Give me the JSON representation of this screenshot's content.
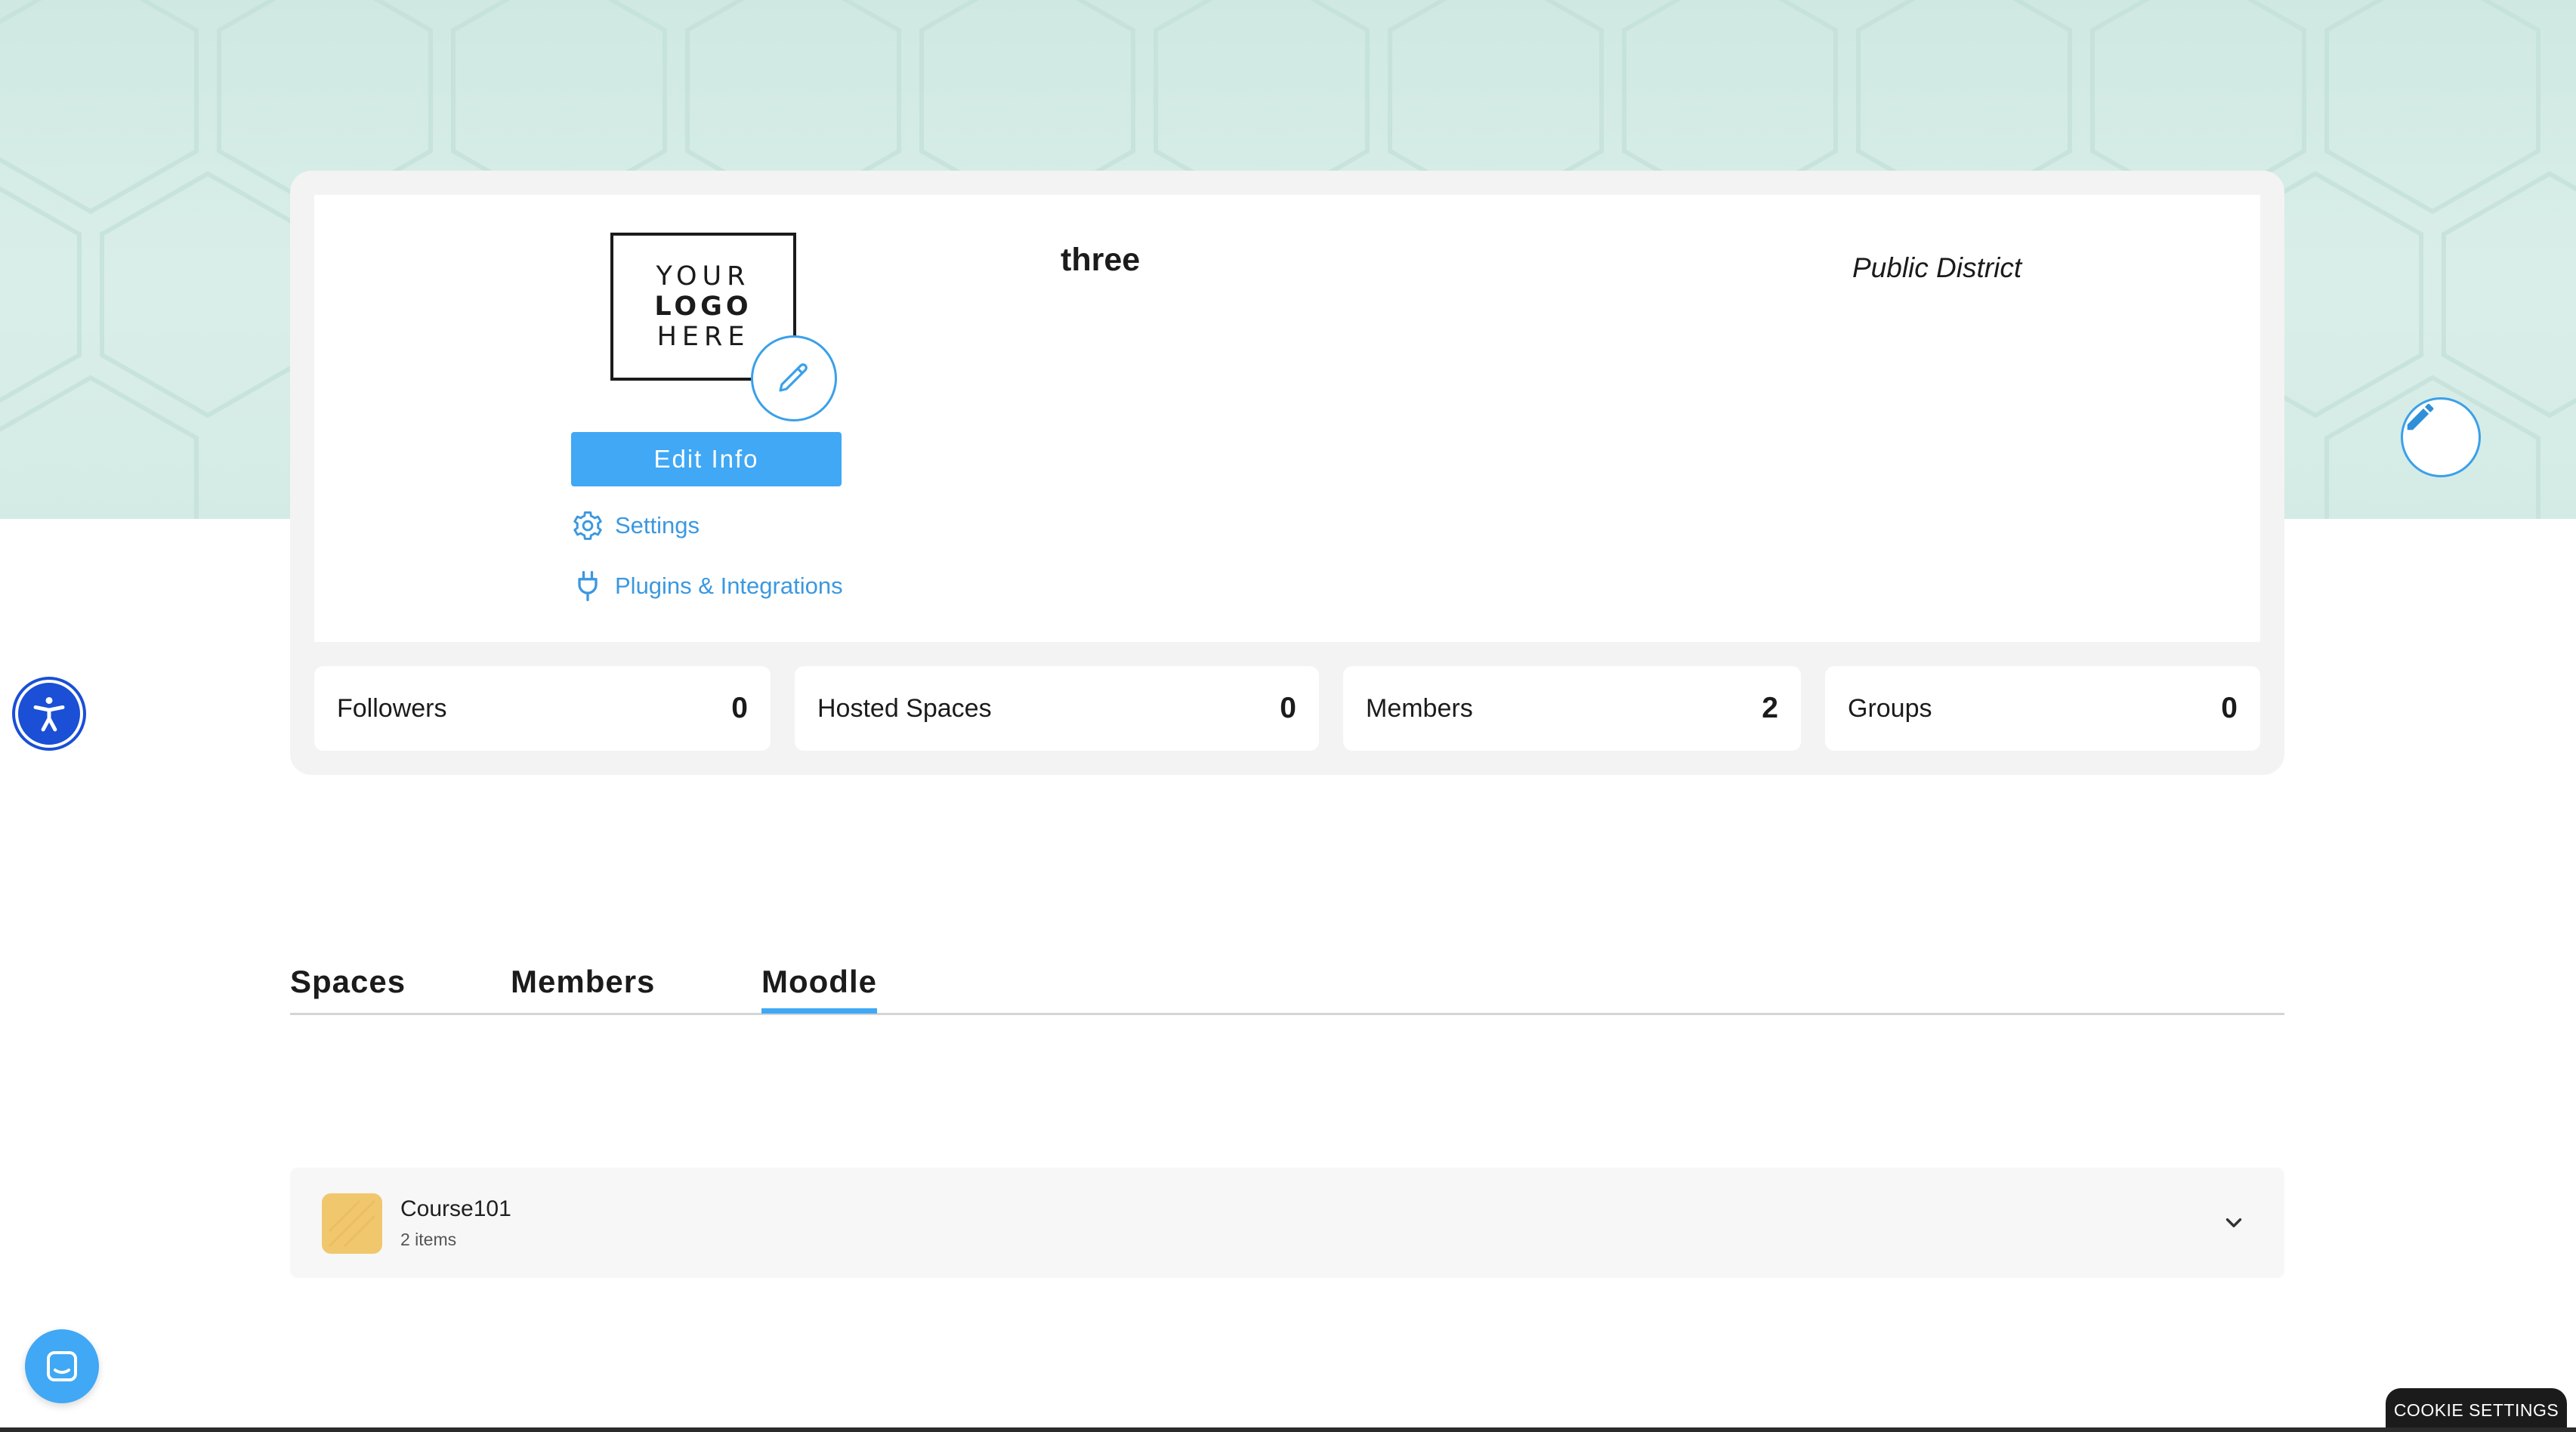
{
  "profile": {
    "logo_lines": [
      "YOUR",
      "LOGO",
      "HERE"
    ],
    "name": "three",
    "type": "Public District",
    "edit_info_label": "Edit Info",
    "settings_label": "Settings",
    "plugins_label": "Plugins & Integrations"
  },
  "stats": [
    {
      "label": "Followers",
      "value": "0"
    },
    {
      "label": "Hosted Spaces",
      "value": "0"
    },
    {
      "label": "Members",
      "value": "2"
    },
    {
      "label": "Groups",
      "value": "0"
    }
  ],
  "tabs": [
    {
      "label": "Spaces",
      "active": false
    },
    {
      "label": "Members",
      "active": false
    },
    {
      "label": "Moodle",
      "active": true
    }
  ],
  "course": {
    "title": "Course101",
    "subtitle": "2 items"
  },
  "cookie_label": "COOKIE SETTINGS",
  "icons": {
    "banner_edit": "pencil-icon",
    "logo_edit": "pencil-outline-icon",
    "settings": "gear-icon",
    "plugins": "plug-icon",
    "accessibility": "accessibility-icon",
    "chat": "chat-icon",
    "chevron": "chevron-down-icon"
  },
  "colors": {
    "accent": "#40a8f5",
    "link": "#3b98e0",
    "banner": "#d4ebe5",
    "accessibility": "#1a4fd6",
    "course_thumb": "#f1c76d"
  }
}
